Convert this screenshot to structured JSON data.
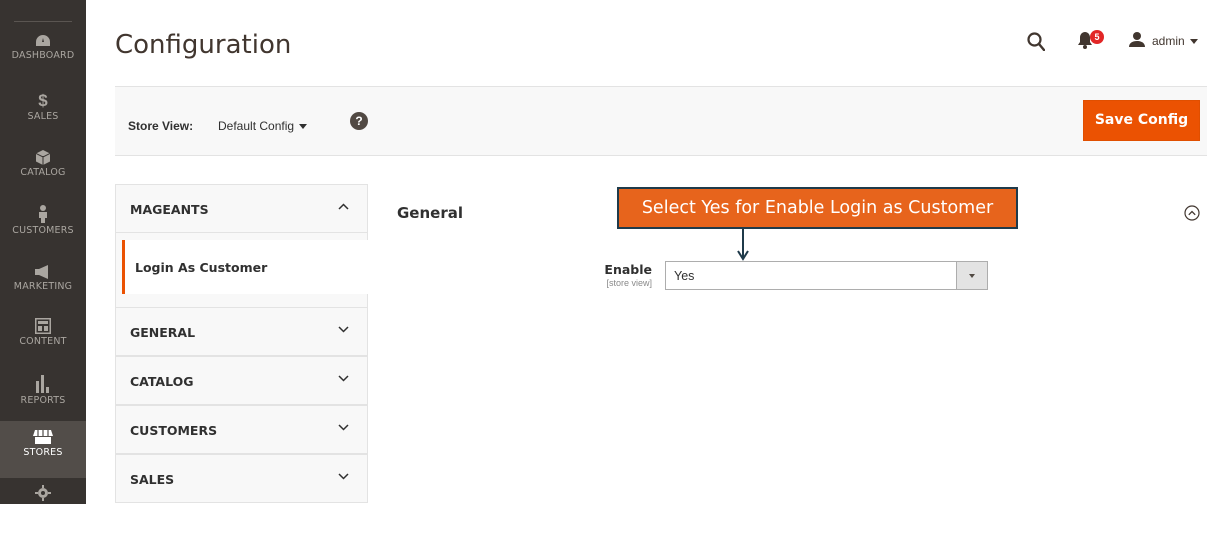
{
  "nav": {
    "items": [
      {
        "label": "DASHBOARD",
        "icon": "dashboard-icon"
      },
      {
        "label": "$",
        "sub": "SALES",
        "icon": "dollar-icon"
      },
      {
        "label": "CATALOG",
        "icon": "cube-icon"
      },
      {
        "label": "CUSTOMERS",
        "icon": "person-icon"
      },
      {
        "label": "MARKETING",
        "icon": "megaphone-icon"
      },
      {
        "label": "CONTENT",
        "icon": "layout-icon"
      },
      {
        "label": "REPORTS",
        "icon": "bar-chart-icon"
      },
      {
        "label": "STORES",
        "icon": "store-icon"
      }
    ],
    "active": "STORES"
  },
  "header": {
    "title": "Configuration",
    "notifications_count": "5",
    "username": "admin"
  },
  "store_bar": {
    "label": "Store View:",
    "value": "Default Config",
    "help": "?",
    "save_label": "Save Config"
  },
  "tabs": {
    "groups": [
      {
        "title": "MAGEANTS",
        "expanded": true,
        "items": [
          "Login As Customer"
        ]
      },
      {
        "title": "GENERAL",
        "expanded": false
      },
      {
        "title": "CATALOG",
        "expanded": false
      },
      {
        "title": "CUSTOMERS",
        "expanded": false
      },
      {
        "title": "SALES",
        "expanded": false
      }
    ]
  },
  "main": {
    "section_title": "General",
    "tooltip": "Select Yes for Enable Login as Customer",
    "field": {
      "label": "Enable",
      "scope": "[store view]",
      "value": "Yes"
    }
  },
  "colors": {
    "nav_bg": "#373330",
    "accent": "#eb5202",
    "tooltip_bg": "#e7641c"
  }
}
